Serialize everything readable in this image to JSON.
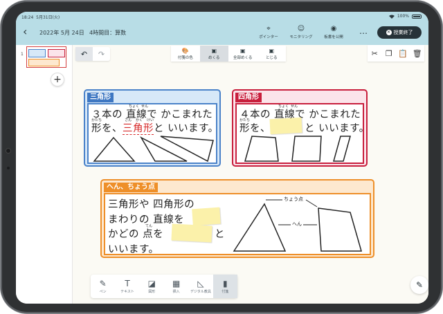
{
  "status": {
    "time": "18:24",
    "date": "5月31日(火)",
    "battery": "100%",
    "wifi_icon": "wifi-icon"
  },
  "header": {
    "back_icon": "chevron-left-icon",
    "date": "2022年 5月 24日",
    "period": "4時間目：算数",
    "tools": [
      {
        "label": "ポインター",
        "icon": "pointer-icon"
      },
      {
        "label": "モニタリング",
        "icon": "monitoring-icon"
      },
      {
        "label": "板書を公開",
        "icon": "eye-icon"
      }
    ],
    "more": "…",
    "end_button": "授業終了"
  },
  "thumbnails": {
    "page_number": "1",
    "add_icon": "plus-icon"
  },
  "sticky_toolbar": [
    {
      "label": "付箋の色",
      "icon": "palette-icon"
    },
    {
      "label": "めくる",
      "icon": "flip-icon",
      "active": true
    },
    {
      "label": "全部めくる",
      "icon": "flip-all-icon"
    },
    {
      "label": "とじる",
      "icon": "close-sticky-icon"
    }
  ],
  "edit_tools": [
    "scissors-icon",
    "copy-icon",
    "paste-icon",
    "trash-icon"
  ],
  "cards": {
    "triangle": {
      "tag": "三角形",
      "line1": "３本の 直線で かこまれた",
      "line2_a": "形を、",
      "line2_red": "三角形",
      "line2_b": "と いいます。",
      "furi_choku": "ちょく",
      "furi_sen": "せん",
      "furi_kata": "かたち",
      "furi_san": "さん",
      "furi_kaku": "かく",
      "furi_kei": "けい"
    },
    "square": {
      "tag": "四角形",
      "line1": "４本の 直線で かこまれた",
      "line2_a": "形を、",
      "line2_b": "と いいます。",
      "furi_choku": "ちょく",
      "furi_sen": "せん",
      "furi_kata": "かたち"
    },
    "edges": {
      "tag": "へん、ちょう点",
      "line1": "三角形や 四角形の",
      "line2": "まわりの 直線を",
      "line3_a": "かどの 点を",
      "line3_b": "と",
      "line4": "いいます。",
      "furi_ten": "てん",
      "label_vertex": "ちょう点",
      "label_edge": "へん"
    }
  },
  "bottom_toolbar": [
    {
      "label": "ペン",
      "icon": "pen-icon"
    },
    {
      "label": "テキスト",
      "icon": "text-icon"
    },
    {
      "label": "図形",
      "icon": "shapes-icon"
    },
    {
      "label": "挿入",
      "icon": "image-icon"
    },
    {
      "label": "デジタル教具",
      "icon": "ruler-icon"
    },
    {
      "label": "付箋",
      "icon": "bookmark-icon",
      "active": true
    }
  ],
  "colors": {
    "header_bg": "#b8dde6",
    "triangle": "#4a82c9",
    "square": "#c81e3c",
    "edges": "#ee8f29",
    "sticky": "#fbf1aa"
  }
}
